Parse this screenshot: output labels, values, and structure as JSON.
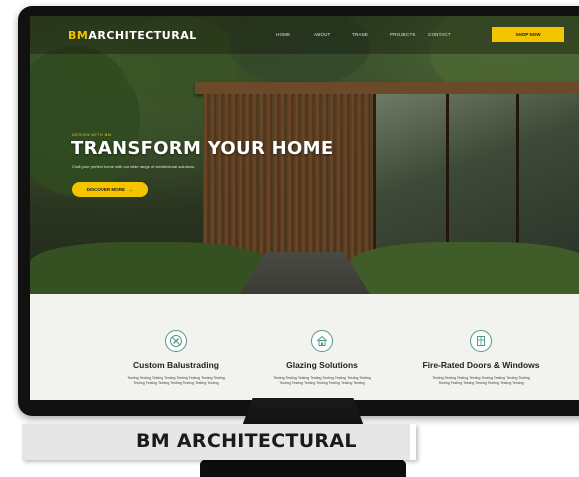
{
  "site": {
    "logo_prefix": "BM",
    "logo_rest": "ARCHITECTURAL"
  },
  "nav": {
    "items": [
      "Home",
      "About",
      "Trade",
      "Projects",
      "Contact"
    ],
    "shop_label": "Shop Now"
  },
  "hero": {
    "eyebrow": "Design with BM",
    "title": "TRANSFORM YOUR HOME",
    "subtitle": "Craft your perfect home with our wide range of architectural solutions.",
    "cta_label": "Discover More",
    "cta_arrow": "→"
  },
  "features": [
    {
      "icon": "no-drill-tools-icon",
      "title": "Custom Balustrading",
      "text": "Testing Testing Testing Testing Testing Testing Testing Testing Testing Testing Testing Testing Testing Testing Testing"
    },
    {
      "icon": "house-icon",
      "title": "Glazing Solutions",
      "text": "Testing Testing Testing Testing Testing Testing Testing Testing Testing Testing Testing Testing Testing Testing Testing"
    },
    {
      "icon": "door-window-icon",
      "title": "Fire-Rated Doors & Windows",
      "text": "Testing Testing Testing Testing Testing Testing Testing Testing Testing Testing Testing Testing Testing Testing Testing"
    }
  ],
  "caption": "BM ARCHITECTURAL",
  "colors": {
    "accent": "#f5c400",
    "icon_teal": "#4f9a86",
    "bezel": "#111111"
  }
}
